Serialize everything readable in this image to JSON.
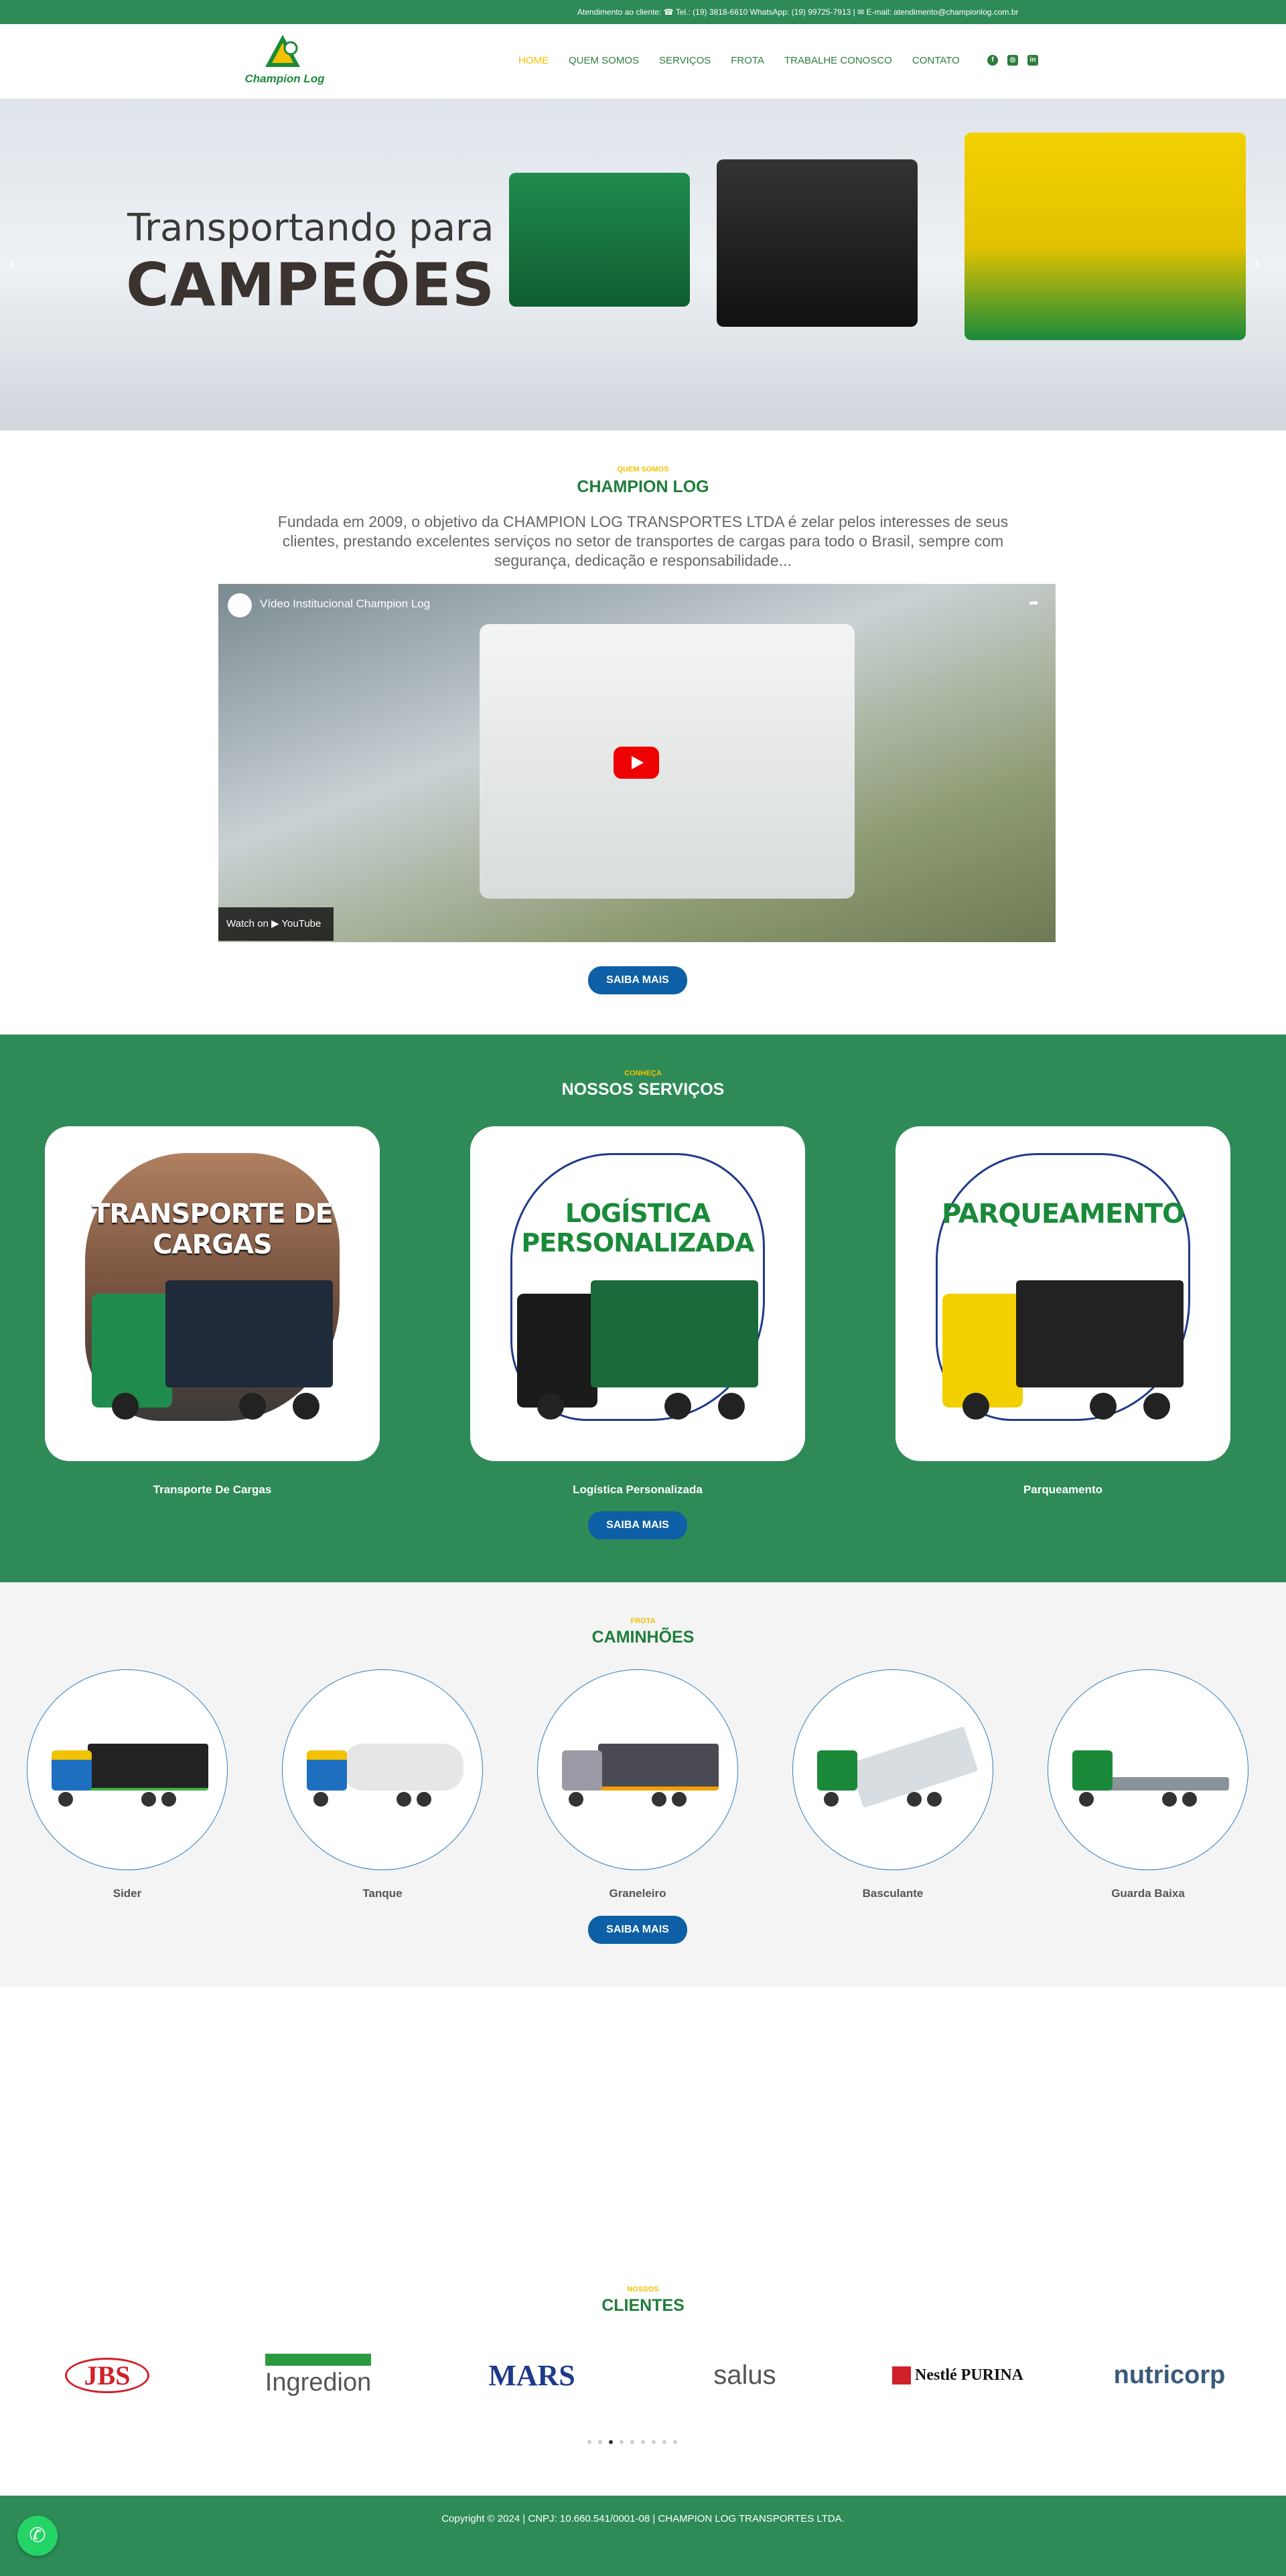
{
  "topbar": {
    "info": "Atendimento ao cliente: ☎ Tel.: (19) 3818-6610 WhatsApp: (19) 99725-7913 | ✉ E-mail: atendimento@championlog.com.br"
  },
  "header": {
    "logo_text": "Champion Log",
    "nav": [
      "HOME",
      "QUEM SOMOS",
      "SERVIÇOS",
      "FROTA",
      "TRABALHE CONOSCO",
      "CONTATO"
    ],
    "social_icons": [
      "facebook-icon",
      "instagram-icon",
      "linkedin-icon"
    ]
  },
  "hero": {
    "line1": "Transportando para",
    "line2": "CAMPEÕES",
    "prev": "‹",
    "next": "›"
  },
  "about": {
    "kicker": "QUEM SOMOS",
    "title": "CHAMPION LOG",
    "description": "Fundada em 2009, o objetivo da CHAMPION LOG TRANSPORTES LTDA é zelar pelos interesses de seus clientes, prestando excelentes serviços no setor de transportes de cargas para todo o Brasil, sempre com segurança, dedicação e responsabilidade...",
    "video_title": "Vídeo Institucional Champion Log",
    "watch_on": "Watch on  ▶ YouTube",
    "button": "SAIBA MAIS"
  },
  "services": {
    "kicker": "CONHEÇA",
    "title": "NOSSOS SERVIÇOS",
    "cards": [
      {
        "card_title": "TRANSPORTE DE CARGAS",
        "label": "Transporte De Cargas"
      },
      {
        "card_title": "LOGÍSTICA PERSONALIZADA",
        "label": "Logística Personalizada"
      },
      {
        "card_title": "PARQUEAMENTO",
        "label": "Parqueamento"
      }
    ],
    "button": "SAIBA MAIS"
  },
  "fleet": {
    "kicker": "FROTA",
    "title": "CAMINHÕES",
    "items": [
      "Sider",
      "Tanque",
      "Graneleiro",
      "Basculante",
      "Guarda Baixa"
    ],
    "button": "SAIBA MAIS"
  },
  "clients": {
    "kicker": "NOSSOS",
    "title": "CLIENTES",
    "logos": [
      "JBS",
      "Ingredion",
      "MARS",
      "salus",
      "Nestlé PURINA",
      "nutricorp"
    ],
    "active_dot": 3,
    "dot_count": 9
  },
  "footer": {
    "copyright": "Copyright © 2024 | CNPJ: 10.660.541/0001-08 | CHAMPION LOG TRANSPORTES LTDA."
  },
  "colors": {
    "brand_green": "#2e8b57",
    "accent_yellow": "#f2c100",
    "button_blue": "#0d5fa6"
  }
}
